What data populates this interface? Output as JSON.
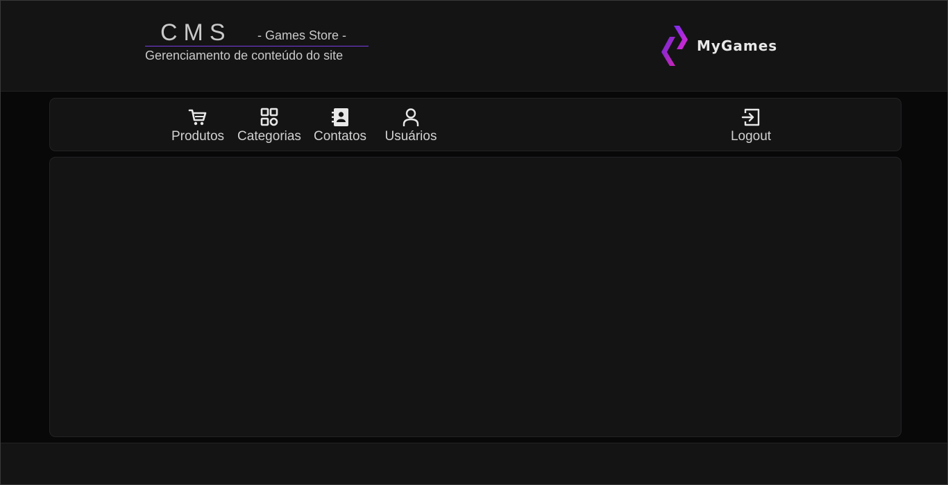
{
  "header": {
    "cms_title": "CMS",
    "store_label": "- Games Store -",
    "subtitle": "Gerenciamento de conteúdo do site",
    "logo_text": "MyGames"
  },
  "nav": {
    "items": [
      {
        "label": "Produtos",
        "icon": "cart-icon"
      },
      {
        "label": "Categorias",
        "icon": "grid-icon"
      },
      {
        "label": "Contatos",
        "icon": "contact-book-icon"
      },
      {
        "label": "Usuários",
        "icon": "user-icon"
      }
    ],
    "logout": {
      "label": "Logout",
      "icon": "logout-icon"
    }
  },
  "colors": {
    "background": "#080808",
    "panel": "#141415",
    "accent": "#7b3fe4",
    "logo_gradient": [
      "#a020f0",
      "#e028c8"
    ]
  }
}
